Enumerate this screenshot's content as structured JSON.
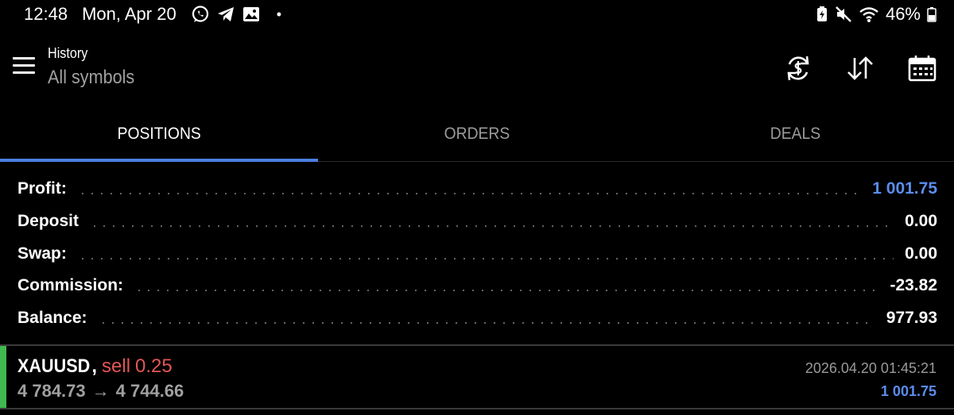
{
  "status_bar": {
    "time": "12:48",
    "date": "Mon, Apr 20",
    "dot": "•",
    "battery_percent": "46%",
    "icons": [
      "whatsapp-icon",
      "telegram-icon",
      "gallery-icon",
      "battery-saver-icon",
      "mute-icon",
      "wifi-icon",
      "battery-icon"
    ]
  },
  "header": {
    "title": "History",
    "subtitle": "All symbols",
    "actions": [
      "currency-exchange-icon",
      "sort-icon",
      "calendar-icon"
    ]
  },
  "tabs": [
    {
      "label": "POSITIONS",
      "active": true
    },
    {
      "label": "ORDERS",
      "active": false
    },
    {
      "label": "DEALS",
      "active": false
    }
  ],
  "summary": {
    "profit_label": "Profit:",
    "profit_value": "1 001.75",
    "deposit_label": "Deposit",
    "deposit_value": "0.00",
    "swap_label": "Swap:",
    "swap_value": "0.00",
    "commission_label": "Commission:",
    "commission_value": "-23.82",
    "balance_label": "Balance:",
    "balance_value": "977.93"
  },
  "positions": [
    {
      "symbol": "XAUUSD",
      "comma": ",",
      "type": "sell",
      "volume": "0.25",
      "open_price": "4 784.73",
      "arrow": "→",
      "close_price": "4 744.66",
      "time": "2026.04.20 01:45:21",
      "profit": "1 001.75"
    }
  ],
  "colors": {
    "background": "#000000",
    "accent_blue": "#5b8def",
    "tab_underline": "#4a7fe0",
    "sell_red": "#e35656",
    "position_bar_green": "#3fb950"
  }
}
